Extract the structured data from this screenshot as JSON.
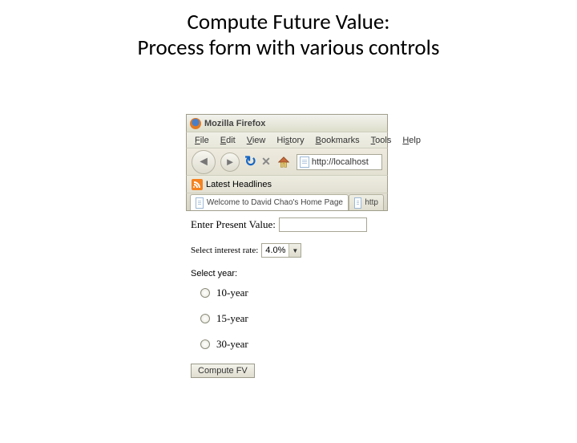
{
  "slide": {
    "title_line1": "Compute Future Value:",
    "title_line2": "Process form with various controls"
  },
  "browser": {
    "title": "Mozilla Firefox",
    "menus": [
      "File",
      "Edit",
      "View",
      "History",
      "Bookmarks",
      "Tools",
      "Help"
    ],
    "url": "http://localhost",
    "bookmarks_label": "Latest Headlines",
    "tabs": [
      {
        "label": "Welcome to David Chao's Home Page"
      },
      {
        "label": "http"
      }
    ]
  },
  "form": {
    "pv_label": "Enter Present Value:",
    "pv_value": "",
    "rate_label": "Select interest rate:",
    "rate_value": "4.0%",
    "year_label": "Select year:",
    "years": [
      "10-year",
      "15-year",
      "30-year"
    ],
    "submit_label": "Compute FV"
  }
}
